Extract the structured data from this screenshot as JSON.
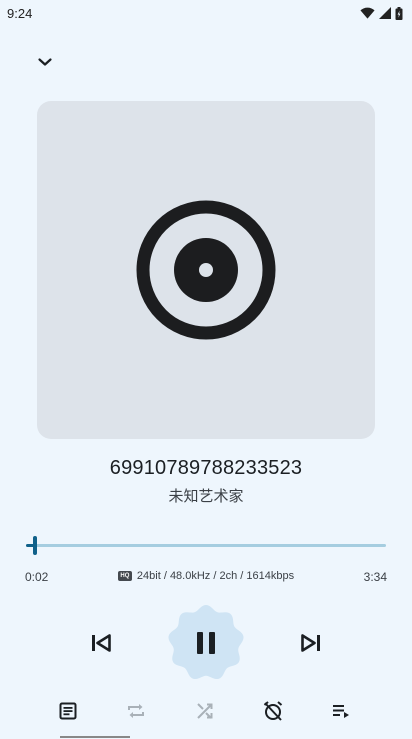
{
  "status_bar": {
    "time": "9:24",
    "icons": [
      "wifi-icon",
      "signal-icon",
      "battery-icon"
    ]
  },
  "header": {
    "collapse_icon": "chevron-down-icon"
  },
  "album_art": {
    "icon": "disc-icon",
    "background": "#dde3ea"
  },
  "track": {
    "title": "69910789788233523",
    "artist": "未知艺术家"
  },
  "playback": {
    "current_time": "0:02",
    "total_time": "3:34",
    "progress_fraction": 0.0093,
    "audio_badge": "HQ",
    "audio_format": "24bit / 48.0kHz / 2ch / 1614kbps"
  },
  "controls": {
    "previous": "skip-previous-icon",
    "play_pause": "pause-icon",
    "next": "skip-next-icon"
  },
  "bottom_bar": {
    "items": [
      "lyrics-icon",
      "repeat-icon",
      "shuffle-icon",
      "sleep-timer-off-icon",
      "queue-icon"
    ]
  },
  "colors": {
    "background": "#eef6fd",
    "accent": "#10618a",
    "track_inactive": "#a5cde0",
    "play_button_bg": "#cfe4f4"
  }
}
